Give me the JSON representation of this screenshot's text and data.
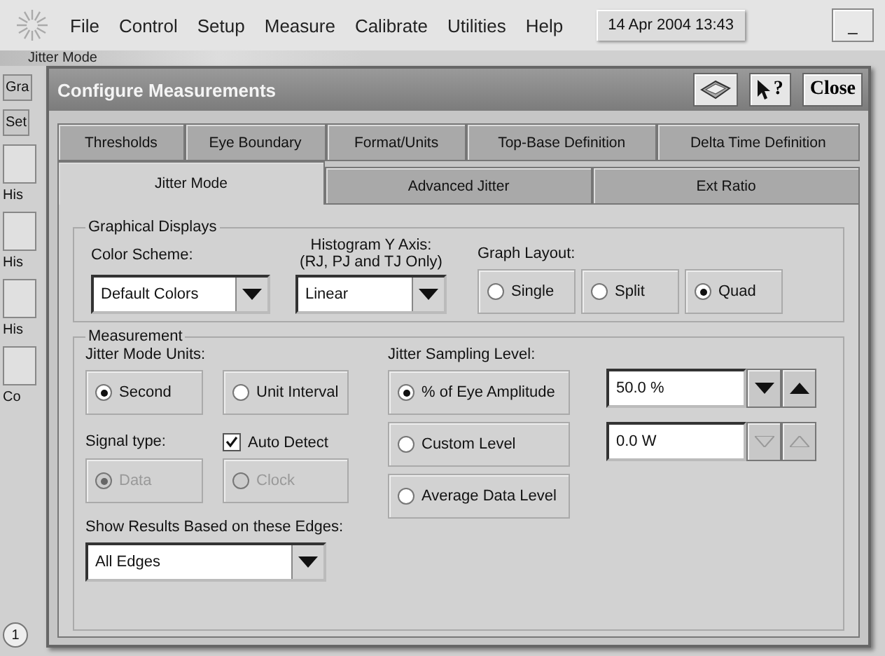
{
  "menu_bar": {
    "items": [
      {
        "label": "File"
      },
      {
        "label": "Control"
      },
      {
        "label": "Setup"
      },
      {
        "label": "Measure"
      },
      {
        "label": "Calibrate"
      },
      {
        "label": "Utilities"
      },
      {
        "label": "Help"
      }
    ],
    "datetime": "14 Apr 2004  13:43",
    "minimize": "_"
  },
  "background": {
    "title": "Jitter Mode",
    "items": [
      {
        "kind": "button",
        "label": "Gra"
      },
      {
        "kind": "button",
        "label": "Set"
      },
      {
        "kind": "tile",
        "label": "His"
      },
      {
        "kind": "tile",
        "label": "His"
      },
      {
        "kind": "tile",
        "label": "His"
      },
      {
        "kind": "tile",
        "label": "Co"
      },
      {
        "kind": "page",
        "label": "1"
      }
    ]
  },
  "dialog": {
    "title": "Configure Measurements",
    "help": "?",
    "close": "Close",
    "tabs_row1": [
      {
        "label": "Thresholds",
        "selected": false
      },
      {
        "label": "Eye Boundary",
        "selected": false
      },
      {
        "label": "Format/Units",
        "selected": false
      },
      {
        "label": "Top-Base Definition",
        "selected": false
      },
      {
        "label": "Delta Time Definition",
        "selected": false
      }
    ],
    "tabs_row2": [
      {
        "label": "Jitter Mode",
        "selected": true
      },
      {
        "label": "Advanced Jitter",
        "selected": false
      },
      {
        "label": "Ext Ratio",
        "selected": false
      }
    ],
    "graphical": {
      "legend": "Graphical Displays",
      "color_scheme": {
        "label": "Color Scheme:",
        "value": "Default Colors"
      },
      "histogram": {
        "label": [
          "Histogram Y Axis:",
          "(RJ, PJ and TJ Only)"
        ],
        "value": "Linear"
      },
      "graph_layout": {
        "label": "Graph Layout:",
        "options": [
          {
            "label": "Single",
            "selected": false,
            "disabled": false
          },
          {
            "label": "Split",
            "selected": false,
            "disabled": false
          },
          {
            "label": "Quad",
            "selected": true,
            "disabled": false
          }
        ]
      }
    },
    "measurement": {
      "legend": "Measurement",
      "units": {
        "label": "Jitter Mode Units:",
        "options": [
          {
            "label": "Second",
            "selected": true,
            "disabled": false
          },
          {
            "label": "Unit Interval",
            "selected": false,
            "disabled": false
          }
        ]
      },
      "signal": {
        "label": "Signal type:",
        "auto_detect": {
          "label": "Auto Detect",
          "checked": true
        },
        "options": [
          {
            "label": "Data",
            "selected": true,
            "disabled": true
          },
          {
            "label": "Clock",
            "selected": false,
            "disabled": true
          }
        ]
      },
      "edges": {
        "label": "Show Results Based on these Edges:",
        "value": "All Edges"
      },
      "sampling": {
        "label": "Jitter Sampling Level:",
        "options": [
          {
            "label": "% of Eye Amplitude",
            "selected": true,
            "disabled": false
          },
          {
            "label": "Custom Level",
            "selected": false,
            "disabled": false
          },
          {
            "label": "Average Data Level",
            "selected": false,
            "disabled": false
          }
        ]
      },
      "spinners": [
        {
          "value": "50.0 %",
          "disabled": false
        },
        {
          "value": "0.0 W",
          "disabled": true
        }
      ]
    }
  }
}
